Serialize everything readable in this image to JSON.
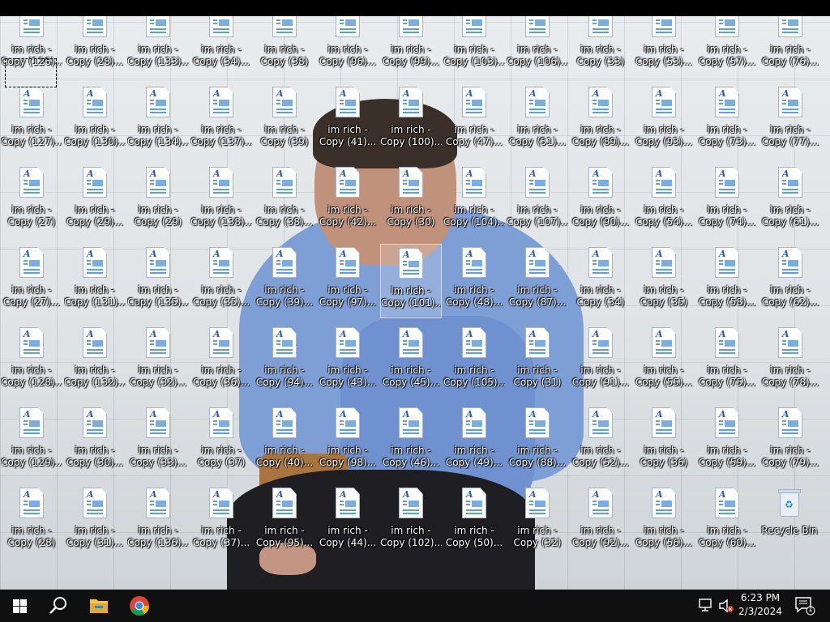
{
  "desktop": {
    "icons": [
      "Copy (126)...",
      "Copy (28)...",
      "Copy (133)...",
      "Copy (34)...",
      "Copy (38)",
      "Copy (96)...",
      "Copy (99)...",
      "Copy (103)...",
      "Copy (106)...",
      "Copy (33)",
      "Copy (53)...",
      "Copy (57)...",
      "Copy (76)...",
      "Copy (127)...",
      "Copy (130)...",
      "Copy (134)...",
      "Copy (137)...",
      "Copy (39)",
      "Copy (41)...",
      "Copy (100)...",
      "Copy (47)...",
      "Copy (51)...",
      "Copy (89)...",
      "Copy (93)...",
      "Copy (73)...",
      "Copy (77)...",
      "Copy (27)",
      "Copy (29)...",
      "Copy (29)",
      "Copy (138)...",
      "Copy (38)...",
      "Copy (42)...",
      "Copy (30)",
      "Copy (104)...",
      "Copy (107)...",
      "Copy (90)...",
      "Copy (54)...",
      "Copy (74)...",
      "Copy (61)...",
      "Copy (27)...",
      "Copy (131)...",
      "Copy (135)...",
      "Copy (35)...",
      "Copy (39)...",
      "Copy (97)...",
      "Copy (101)...",
      "Copy (48)...",
      "Copy (87)...",
      "Copy (34)",
      "Copy (35)",
      "Copy (58)...",
      "Copy (62)...",
      "Copy (128)...",
      "Copy (132)...",
      "Copy (32)...",
      "Copy (36)...",
      "Copy (94)...",
      "Copy (43)...",
      "Copy (45)...",
      "Copy (105)...",
      "Copy (31)",
      "Copy (91)...",
      "Copy (55)...",
      "Copy (75)...",
      "Copy (78)...",
      "Copy (129)...",
      "Copy (30)...",
      "Copy (33)...",
      "Copy (37)",
      "Copy (40)...",
      "Copy (98)...",
      "Copy (46)...",
      "Copy (49)...",
      "Copy (88)...",
      "Copy (52)...",
      "Copy (36)",
      "Copy (59)...",
      "Copy (79)...",
      "Copy (28)",
      "Copy (31)...",
      "Copy (136)...",
      "Copy (37)...",
      "Copy (95)...",
      "Copy (44)...",
      "Copy (102)...",
      "Copy (50)...",
      "Copy (32)",
      "Copy (92)...",
      "Copy (56)...",
      "Copy (60)..."
    ],
    "name_prefix": "im rich -",
    "recycle_bin": "Recycle Bin"
  },
  "taskbar": {
    "time": "6:23 PM",
    "date": "2/3/2024",
    "notification_count": "1"
  },
  "colors": {
    "taskbar": "#101010",
    "doc_accent": "#2b59c3"
  }
}
